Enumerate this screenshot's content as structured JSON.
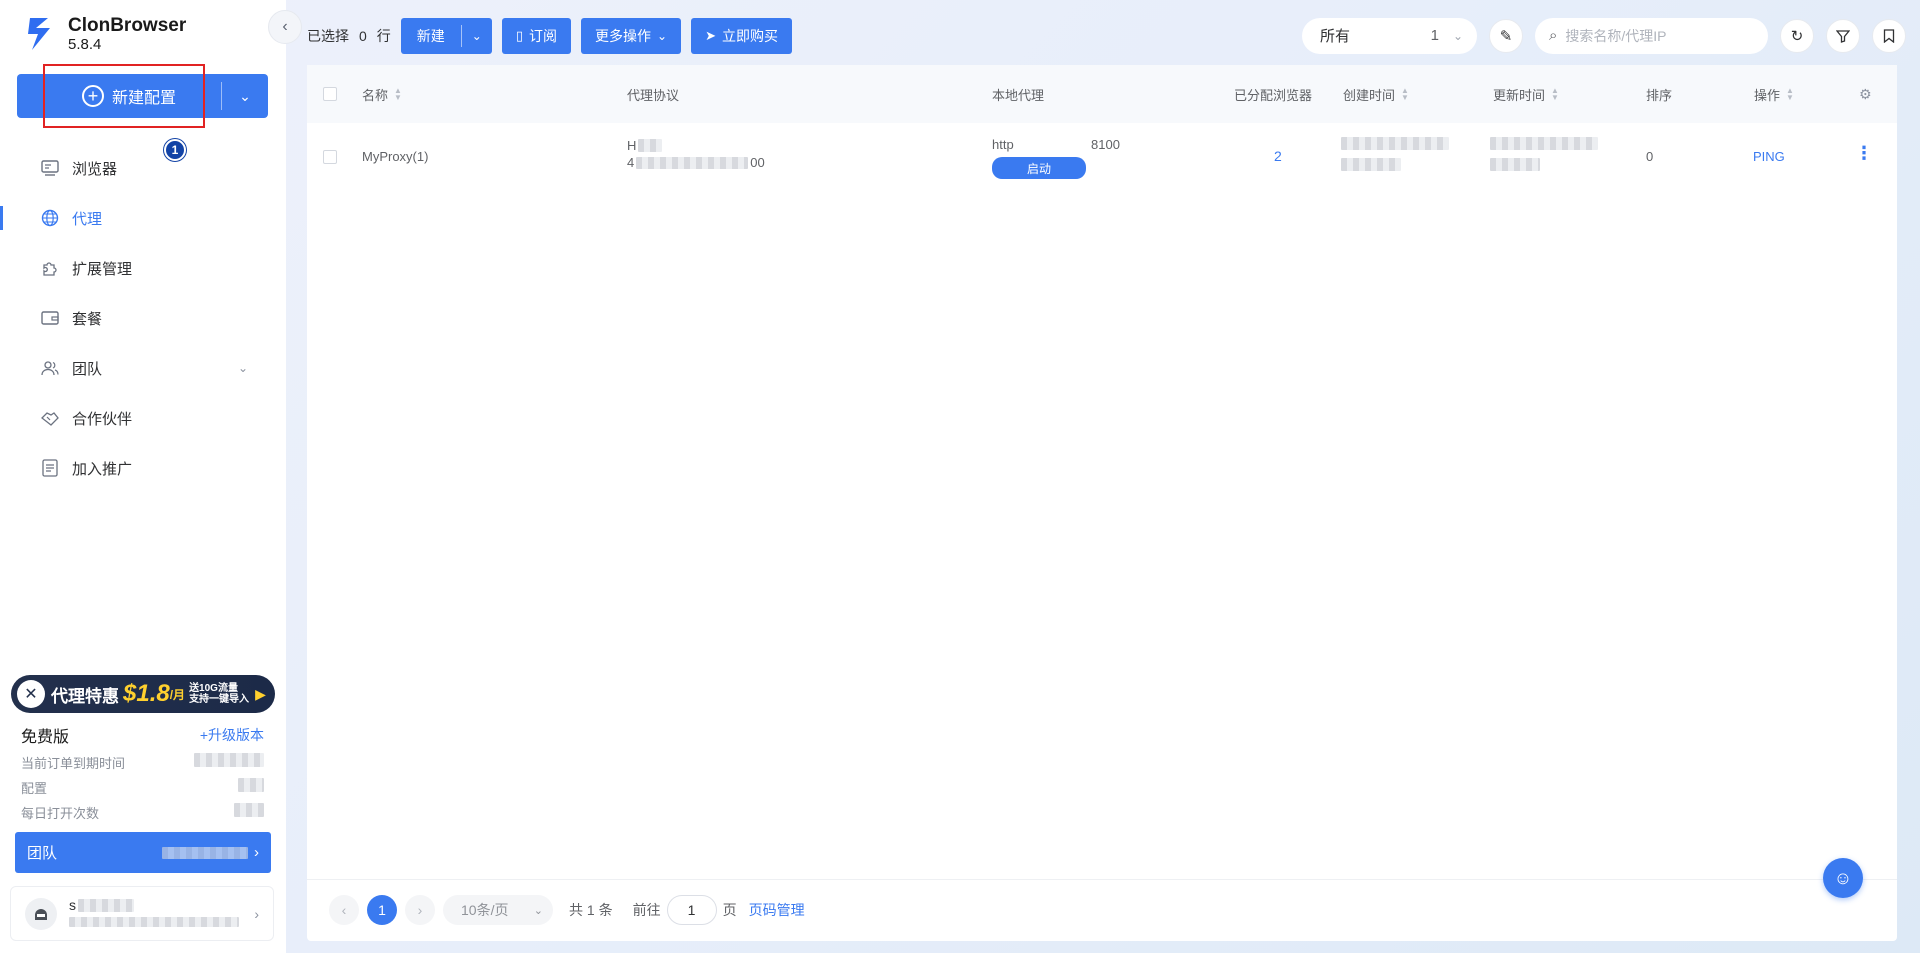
{
  "app": {
    "name": "ClonBrowser",
    "version": "5.8.4"
  },
  "sidebar": {
    "new_config_label": "新建配置",
    "step_badge": "1",
    "items": [
      {
        "label": "浏览器",
        "icon": "browser-icon"
      },
      {
        "label": "代理",
        "icon": "globe-icon",
        "active": true
      },
      {
        "label": "扩展管理",
        "icon": "puzzle-icon"
      },
      {
        "label": "套餐",
        "icon": "wallet-icon"
      },
      {
        "label": "团队",
        "icon": "team-icon",
        "expandable": true
      },
      {
        "label": "合作伙伴",
        "icon": "handshake-icon"
      },
      {
        "label": "加入推广",
        "icon": "promotion-icon"
      }
    ],
    "promo": {
      "text": "代理特惠",
      "price": "$1.8",
      "unit": "/月",
      "note_line1": "送10G流量",
      "note_line2": "支持一键导入"
    },
    "plan": {
      "name": "免费版",
      "upgrade": "+升级版本",
      "rows": [
        "当前订单到期时间",
        "配置",
        "每日打开次数"
      ]
    },
    "team_button": {
      "label": "团队"
    },
    "user": {
      "initial": "s"
    }
  },
  "toolbar": {
    "selected_prefix": "已选择",
    "selected_count": "0",
    "selected_suffix": "行",
    "new_label": "新建",
    "subscribe_label": "订阅",
    "more_label": "更多操作",
    "buy_label": "立即购买",
    "filter_value": "所有",
    "filter_count": "1",
    "search_placeholder": "搜索名称/代理IP"
  },
  "table": {
    "columns": {
      "name": "名称",
      "protocol": "代理协议",
      "local_proxy": "本地代理",
      "assigned": "已分配浏览器",
      "created": "创建时间",
      "updated": "更新时间",
      "order": "排序",
      "actions": "操作"
    },
    "rows": [
      {
        "name": "MyProxy(1)",
        "protocol_line1": "H",
        "protocol_line2_start": "4",
        "protocol_line2_end": "00",
        "local_type": "http",
        "local_port": "8100",
        "start_label": "启动",
        "assigned": "2",
        "order": "0",
        "action": "PING"
      }
    ]
  },
  "pagination": {
    "current": "1",
    "page_size": "10条/页",
    "total": "共 1 条",
    "goto_prefix": "前往",
    "goto_value": "1",
    "goto_suffix": "页",
    "manage": "页码管理"
  },
  "colors": {
    "accent": "#3a7af0",
    "highlight_box": "#e12323",
    "promo_yellow": "#ffd02e"
  }
}
